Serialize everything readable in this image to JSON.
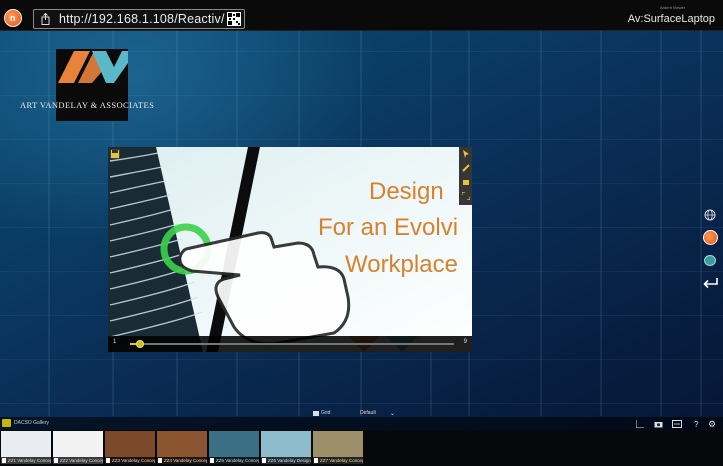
{
  "topbar": {
    "url": "http://192.168.1.108/Reactiv/",
    "small_text": "Ardent Viewer",
    "device_name": "Av:SurfaceLaptop"
  },
  "company": {
    "name": "ART VANDELAY & ASSOCIATES",
    "logo_colors": [
      "#e8833a",
      "#5bb8c8"
    ]
  },
  "slide": {
    "title_lines": [
      "Design",
      "For an Evolvi",
      "Workplace"
    ],
    "title_color": "#d7822e",
    "current_page": "1",
    "total_pages": "9",
    "progress": 0.03
  },
  "right_toolbar": {
    "icons": [
      "globe-icon",
      "app-logo-icon",
      "brain-icon",
      "back-arrow-icon"
    ]
  },
  "bottom": {
    "folder_label": "DACSO Gallery",
    "view_label": "Grid",
    "layout_label": "Default",
    "thumbnails": [
      {
        "caption": "ZZ1 Vandelay Concepts_01",
        "color": "#e9ecf0"
      },
      {
        "caption": "ZZ2 Vandelay Concepts_Floor Plan",
        "color": "#f2f2f2"
      },
      {
        "caption": "ZZ3 Vandelay Concepts",
        "color": "#7a4a2a"
      },
      {
        "caption": "ZZ4 Vandelay Concepts",
        "color": "#8a5530"
      },
      {
        "caption": "ZZ5 Vandelay Concepts_Architecture",
        "color": "#3b6f86"
      },
      {
        "caption": "ZZ6 Vandelay Design for an Evolving Workplace",
        "color": "#8fbccc"
      },
      {
        "caption": "ZZ7 Vandelay Concepts Video",
        "color": "#9d8f6a"
      }
    ]
  }
}
